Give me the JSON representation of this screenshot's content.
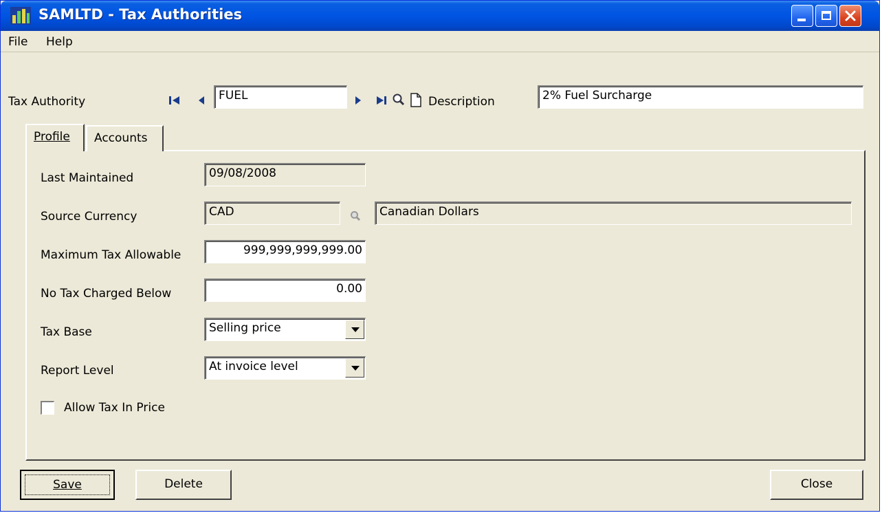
{
  "window": {
    "title": "SAMLTD - Tax Authorities"
  },
  "menu": {
    "file": "File",
    "help": "Help"
  },
  "header": {
    "tax_authority_label": "Tax Authority",
    "tax_authority_value": "FUEL",
    "description_label": "Description",
    "description_value": "2% Fuel Surcharge"
  },
  "tabs": {
    "profile": "Profile",
    "accounts": "Accounts"
  },
  "profile": {
    "last_maintained_label": "Last Maintained",
    "last_maintained_value": "09/08/2008",
    "source_currency_label": "Source Currency",
    "source_currency_code": "CAD",
    "source_currency_name": "Canadian Dollars",
    "max_tax_label": "Maximum Tax Allowable",
    "max_tax_value": "999,999,999,999.00",
    "no_tax_below_label": "No Tax Charged Below",
    "no_tax_below_value": "0.00",
    "tax_base_label": "Tax Base",
    "tax_base_value": "Selling price",
    "report_level_label": "Report Level",
    "report_level_value": "At invoice level",
    "allow_tax_label": "Allow Tax In Price",
    "allow_tax_checked": false
  },
  "buttons": {
    "save": "Save",
    "delete": "Delete",
    "close": "Close"
  },
  "colors": {
    "titlebar": "#0054e3",
    "window_bg": "#ece9d8",
    "close_red": "#d9441f"
  }
}
